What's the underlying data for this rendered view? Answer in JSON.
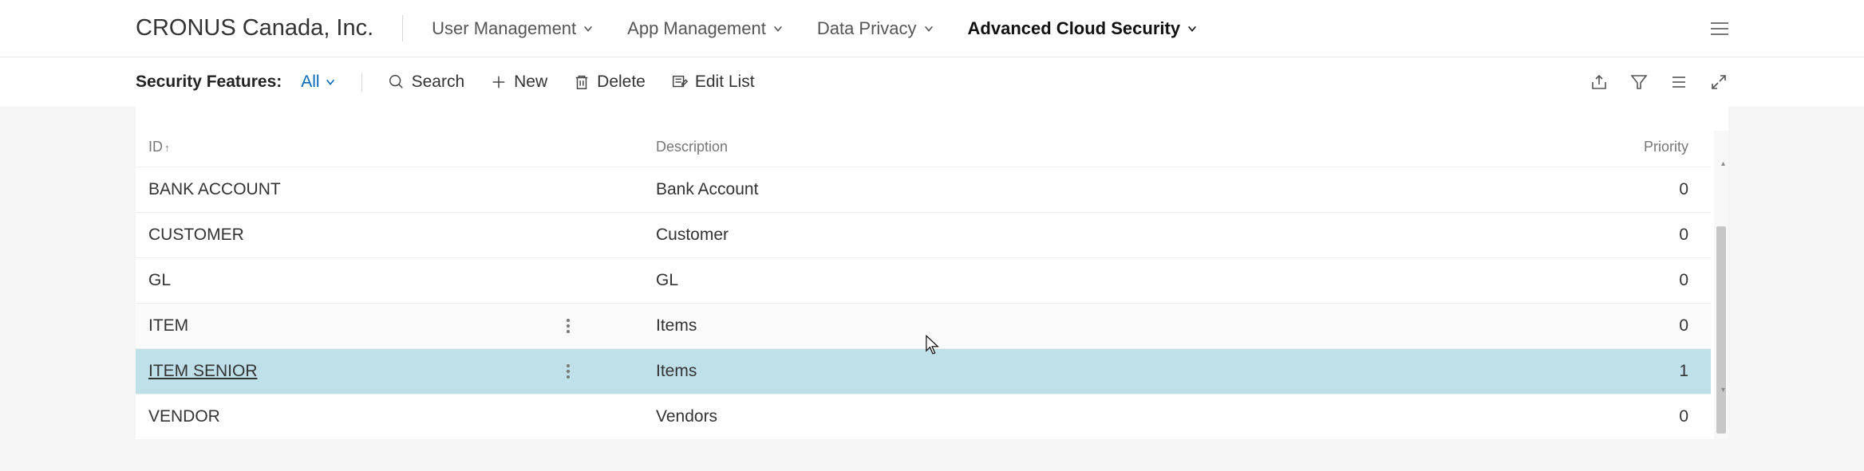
{
  "header": {
    "company": "CRONUS Canada, Inc.",
    "nav": [
      {
        "label": "User Management",
        "active": false
      },
      {
        "label": "App Management",
        "active": false
      },
      {
        "label": "Data Privacy",
        "active": false
      },
      {
        "label": "Advanced Cloud Security",
        "active": true
      }
    ]
  },
  "toolbar": {
    "list_label": "Security Features:",
    "filter_value": "All",
    "actions": {
      "search": "Search",
      "new": "New",
      "delete": "Delete",
      "editlist": "Edit List"
    }
  },
  "table": {
    "columns": {
      "id": "ID",
      "description": "Description",
      "priority": "Priority"
    },
    "sort": {
      "column": "id",
      "direction": "asc"
    },
    "rows": [
      {
        "id": "BANK ACCOUNT",
        "description": "Bank Account",
        "priority": 0,
        "show_menu": false,
        "selected": false,
        "hovered": false
      },
      {
        "id": "CUSTOMER",
        "description": "Customer",
        "priority": 0,
        "show_menu": false,
        "selected": false,
        "hovered": false
      },
      {
        "id": "GL",
        "description": "GL",
        "priority": 0,
        "show_menu": false,
        "selected": false,
        "hovered": false
      },
      {
        "id": "ITEM",
        "description": "Items",
        "priority": 0,
        "show_menu": true,
        "selected": false,
        "hovered": true
      },
      {
        "id": "ITEM SENIOR",
        "description": "Items",
        "priority": 1,
        "show_menu": true,
        "selected": true,
        "hovered": false
      },
      {
        "id": "VENDOR",
        "description": "Vendors",
        "priority": 0,
        "show_menu": false,
        "selected": false,
        "hovered": false
      }
    ]
  }
}
